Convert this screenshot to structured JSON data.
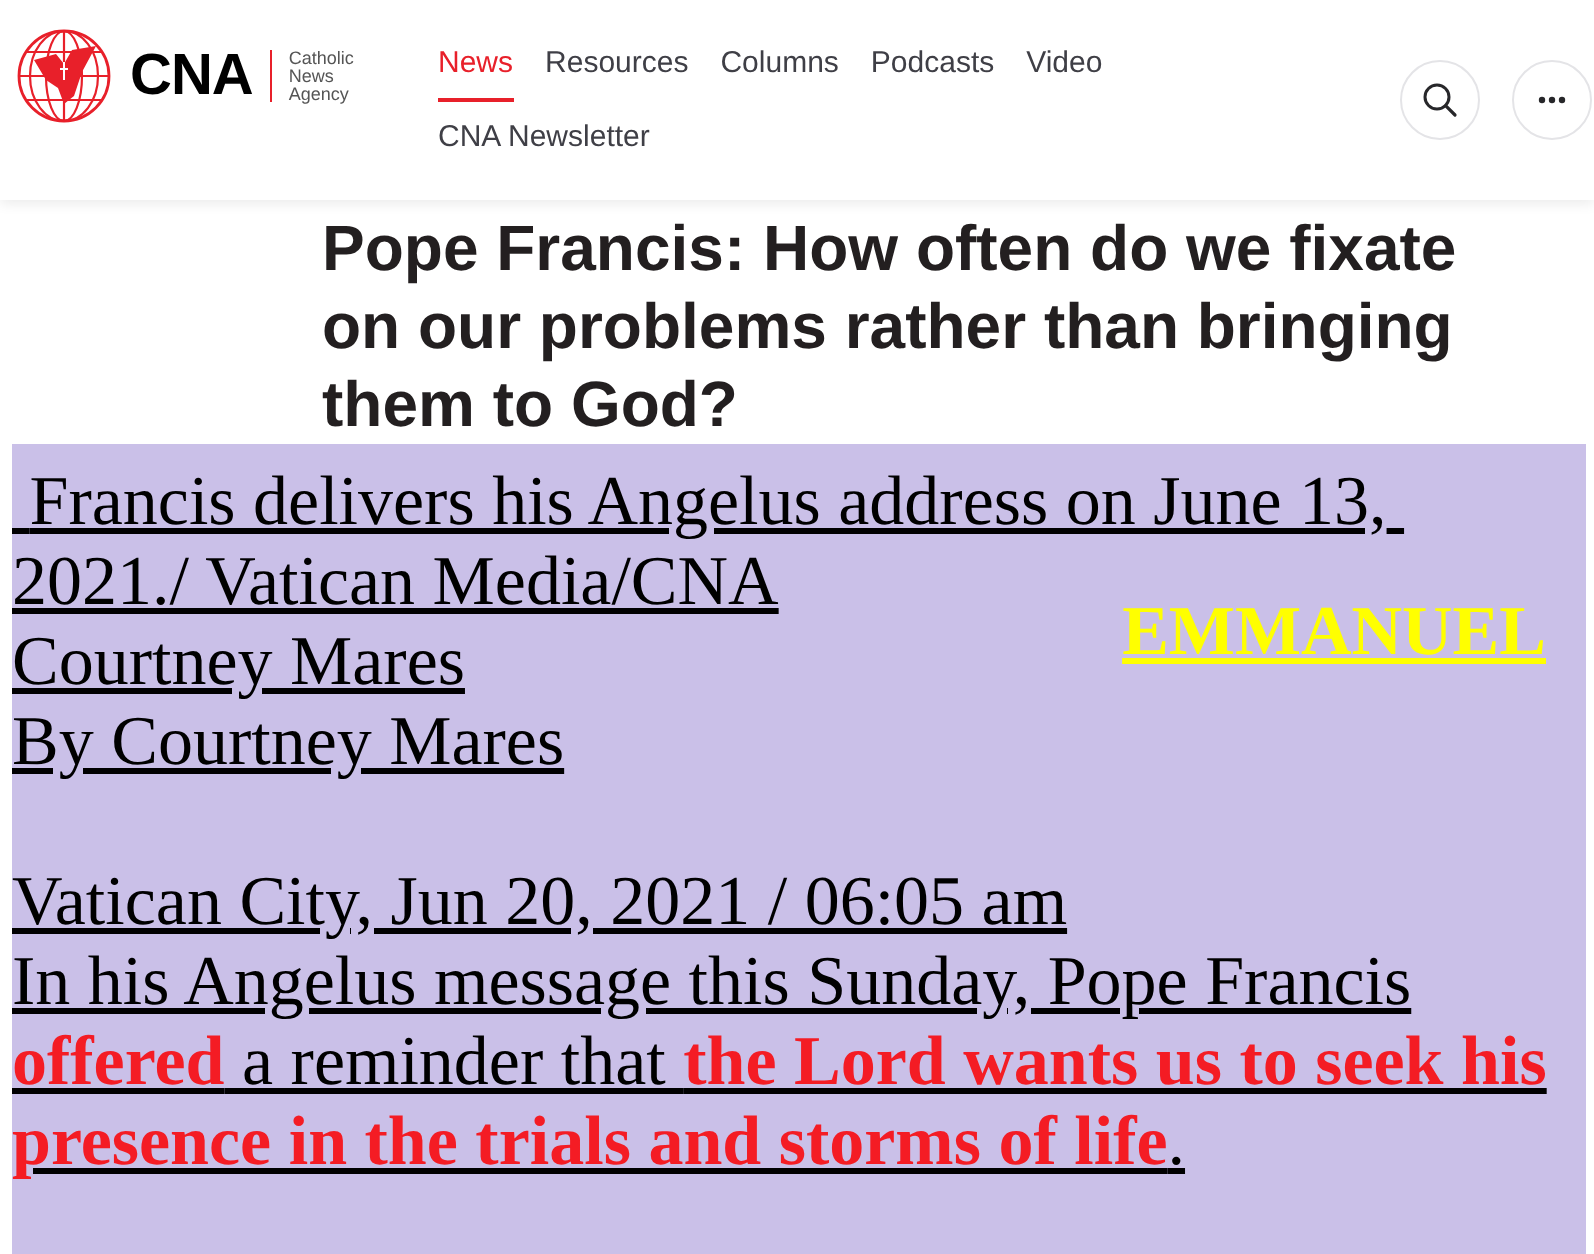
{
  "header": {
    "logo": {
      "wordmark": "CNA",
      "tagline": "Catholic News Agency"
    },
    "nav": [
      {
        "label": "News",
        "selected": true
      },
      {
        "label": "Resources",
        "selected": false
      },
      {
        "label": "Columns",
        "selected": false
      },
      {
        "label": "Podcasts",
        "selected": false
      },
      {
        "label": "Video",
        "selected": false
      }
    ],
    "nav_secondary": [
      {
        "label": "CNA Newsletter",
        "selected": false
      }
    ],
    "actions": [
      {
        "kind": "search"
      },
      {
        "kind": "more"
      }
    ]
  },
  "article": {
    "title": "Pope Francis: How often do we fixate on our problems rather than bringing them to God?",
    "caption": " Francis delivers his Angelus address on June 13, 2021./ Vatican Media/CNA",
    "photo_credit": "Courtney Mares",
    "overlay_text": "EMMANUEL",
    "byline": "By Courtney Mares",
    "dateline": "Vatican City, Jun 20, 2021 / 06:05 am",
    "body": "In his Angelus message this Sunday, Pope Francis **offered** a reminder that **the Lord wants us to seek his presence in the trials and storms of life**."
  }
}
